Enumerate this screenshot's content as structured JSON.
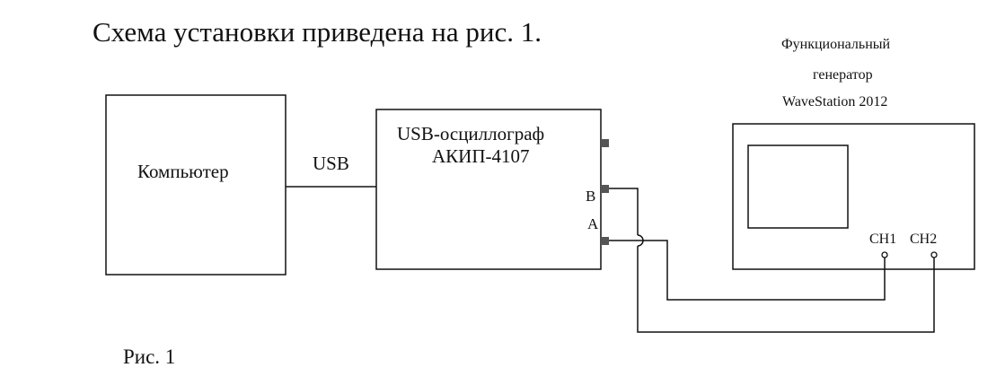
{
  "heading": "Схема установки приведена на рис. 1.",
  "computer": {
    "label": "Компьютер"
  },
  "link": {
    "label": "USB"
  },
  "oscilloscope": {
    "line1": "USB-осциллограф",
    "line2": "АКИП-4107",
    "port_b": "B",
    "port_a": "A"
  },
  "generator": {
    "title_line1": "Функциональный",
    "title_line2": "генератор",
    "title_line3": "WaveStation 2012",
    "ch1": "CH1",
    "ch2": "CH2"
  },
  "caption": "Рис. 1"
}
